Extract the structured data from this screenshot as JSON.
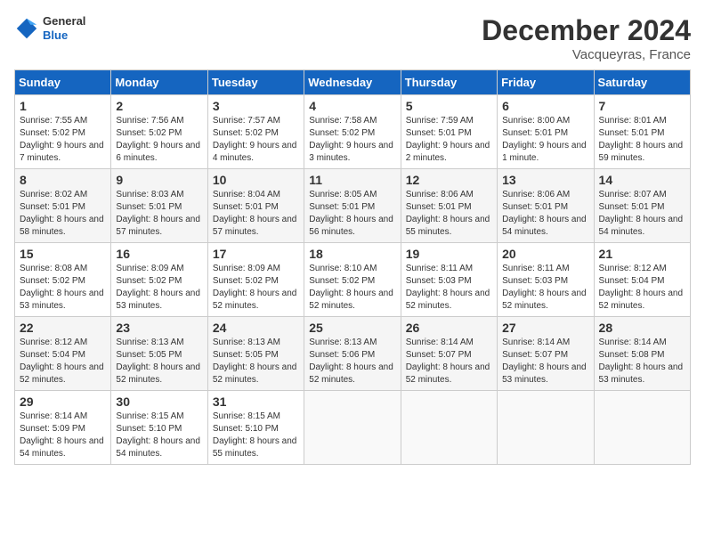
{
  "header": {
    "logo": {
      "general": "General",
      "blue": "Blue"
    },
    "title": "December 2024",
    "location": "Vacqueyras, France"
  },
  "calendar": {
    "days_of_week": [
      "Sunday",
      "Monday",
      "Tuesday",
      "Wednesday",
      "Thursday",
      "Friday",
      "Saturday"
    ],
    "weeks": [
      [
        {
          "day": "1",
          "sunrise": "Sunrise: 7:55 AM",
          "sunset": "Sunset: 5:02 PM",
          "daylight": "Daylight: 9 hours and 7 minutes."
        },
        {
          "day": "2",
          "sunrise": "Sunrise: 7:56 AM",
          "sunset": "Sunset: 5:02 PM",
          "daylight": "Daylight: 9 hours and 6 minutes."
        },
        {
          "day": "3",
          "sunrise": "Sunrise: 7:57 AM",
          "sunset": "Sunset: 5:02 PM",
          "daylight": "Daylight: 9 hours and 4 minutes."
        },
        {
          "day": "4",
          "sunrise": "Sunrise: 7:58 AM",
          "sunset": "Sunset: 5:02 PM",
          "daylight": "Daylight: 9 hours and 3 minutes."
        },
        {
          "day": "5",
          "sunrise": "Sunrise: 7:59 AM",
          "sunset": "Sunset: 5:01 PM",
          "daylight": "Daylight: 9 hours and 2 minutes."
        },
        {
          "day": "6",
          "sunrise": "Sunrise: 8:00 AM",
          "sunset": "Sunset: 5:01 PM",
          "daylight": "Daylight: 9 hours and 1 minute."
        },
        {
          "day": "7",
          "sunrise": "Sunrise: 8:01 AM",
          "sunset": "Sunset: 5:01 PM",
          "daylight": "Daylight: 8 hours and 59 minutes."
        }
      ],
      [
        {
          "day": "8",
          "sunrise": "Sunrise: 8:02 AM",
          "sunset": "Sunset: 5:01 PM",
          "daylight": "Daylight: 8 hours and 58 minutes."
        },
        {
          "day": "9",
          "sunrise": "Sunrise: 8:03 AM",
          "sunset": "Sunset: 5:01 PM",
          "daylight": "Daylight: 8 hours and 57 minutes."
        },
        {
          "day": "10",
          "sunrise": "Sunrise: 8:04 AM",
          "sunset": "Sunset: 5:01 PM",
          "daylight": "Daylight: 8 hours and 57 minutes."
        },
        {
          "day": "11",
          "sunrise": "Sunrise: 8:05 AM",
          "sunset": "Sunset: 5:01 PM",
          "daylight": "Daylight: 8 hours and 56 minutes."
        },
        {
          "day": "12",
          "sunrise": "Sunrise: 8:06 AM",
          "sunset": "Sunset: 5:01 PM",
          "daylight": "Daylight: 8 hours and 55 minutes."
        },
        {
          "day": "13",
          "sunrise": "Sunrise: 8:06 AM",
          "sunset": "Sunset: 5:01 PM",
          "daylight": "Daylight: 8 hours and 54 minutes."
        },
        {
          "day": "14",
          "sunrise": "Sunrise: 8:07 AM",
          "sunset": "Sunset: 5:01 PM",
          "daylight": "Daylight: 8 hours and 54 minutes."
        }
      ],
      [
        {
          "day": "15",
          "sunrise": "Sunrise: 8:08 AM",
          "sunset": "Sunset: 5:02 PM",
          "daylight": "Daylight: 8 hours and 53 minutes."
        },
        {
          "day": "16",
          "sunrise": "Sunrise: 8:09 AM",
          "sunset": "Sunset: 5:02 PM",
          "daylight": "Daylight: 8 hours and 53 minutes."
        },
        {
          "day": "17",
          "sunrise": "Sunrise: 8:09 AM",
          "sunset": "Sunset: 5:02 PM",
          "daylight": "Daylight: 8 hours and 52 minutes."
        },
        {
          "day": "18",
          "sunrise": "Sunrise: 8:10 AM",
          "sunset": "Sunset: 5:02 PM",
          "daylight": "Daylight: 8 hours and 52 minutes."
        },
        {
          "day": "19",
          "sunrise": "Sunrise: 8:11 AM",
          "sunset": "Sunset: 5:03 PM",
          "daylight": "Daylight: 8 hours and 52 minutes."
        },
        {
          "day": "20",
          "sunrise": "Sunrise: 8:11 AM",
          "sunset": "Sunset: 5:03 PM",
          "daylight": "Daylight: 8 hours and 52 minutes."
        },
        {
          "day": "21",
          "sunrise": "Sunrise: 8:12 AM",
          "sunset": "Sunset: 5:04 PM",
          "daylight": "Daylight: 8 hours and 52 minutes."
        }
      ],
      [
        {
          "day": "22",
          "sunrise": "Sunrise: 8:12 AM",
          "sunset": "Sunset: 5:04 PM",
          "daylight": "Daylight: 8 hours and 52 minutes."
        },
        {
          "day": "23",
          "sunrise": "Sunrise: 8:13 AM",
          "sunset": "Sunset: 5:05 PM",
          "daylight": "Daylight: 8 hours and 52 minutes."
        },
        {
          "day": "24",
          "sunrise": "Sunrise: 8:13 AM",
          "sunset": "Sunset: 5:05 PM",
          "daylight": "Daylight: 8 hours and 52 minutes."
        },
        {
          "day": "25",
          "sunrise": "Sunrise: 8:13 AM",
          "sunset": "Sunset: 5:06 PM",
          "daylight": "Daylight: 8 hours and 52 minutes."
        },
        {
          "day": "26",
          "sunrise": "Sunrise: 8:14 AM",
          "sunset": "Sunset: 5:07 PM",
          "daylight": "Daylight: 8 hours and 52 minutes."
        },
        {
          "day": "27",
          "sunrise": "Sunrise: 8:14 AM",
          "sunset": "Sunset: 5:07 PM",
          "daylight": "Daylight: 8 hours and 53 minutes."
        },
        {
          "day": "28",
          "sunrise": "Sunrise: 8:14 AM",
          "sunset": "Sunset: 5:08 PM",
          "daylight": "Daylight: 8 hours and 53 minutes."
        }
      ],
      [
        {
          "day": "29",
          "sunrise": "Sunrise: 8:14 AM",
          "sunset": "Sunset: 5:09 PM",
          "daylight": "Daylight: 8 hours and 54 minutes."
        },
        {
          "day": "30",
          "sunrise": "Sunrise: 8:15 AM",
          "sunset": "Sunset: 5:10 PM",
          "daylight": "Daylight: 8 hours and 54 minutes."
        },
        {
          "day": "31",
          "sunrise": "Sunrise: 8:15 AM",
          "sunset": "Sunset: 5:10 PM",
          "daylight": "Daylight: 8 hours and 55 minutes."
        },
        null,
        null,
        null,
        null
      ]
    ]
  }
}
